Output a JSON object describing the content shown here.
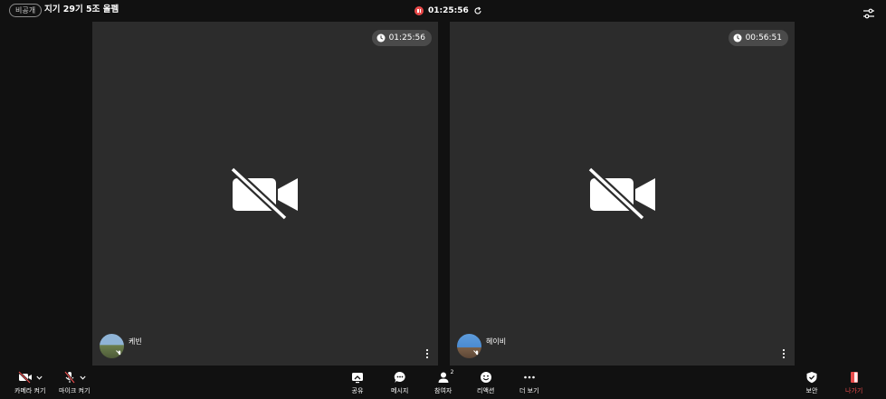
{
  "header": {
    "privacy_label": "비공개",
    "meeting_title": "지기 29기 5조 올펨",
    "record_time": "01:25:56"
  },
  "tiles": [
    {
      "timer": "01:25:56",
      "participant_name": "케빈"
    },
    {
      "timer": "00:56:51",
      "participant_name": "헤이비"
    }
  ],
  "toolbar": {
    "camera_label": "카메라 켜기",
    "mic_label": "마이크 켜기",
    "share_label": "공유",
    "message_label": "메시지",
    "participants_label": "참여자",
    "participants_count": "2",
    "reaction_label": "리액션",
    "more_label": "더 보기",
    "security_label": "보안",
    "leave_label": "나가기"
  },
  "colors": {
    "background": "#111111",
    "tile": "#2c2c2c",
    "record_red": "#e84a4a",
    "leave_red": "#e84a4a"
  },
  "icons": [
    "record-icon",
    "refresh-icon",
    "settings-sliders-icon",
    "clock-icon",
    "camera-off-icon",
    "mic-off-icon",
    "more-vertical-icon",
    "chevron-down-icon",
    "share-icon",
    "message-icon",
    "participants-icon",
    "reaction-icon",
    "more-horizontal-icon",
    "shield-icon",
    "exit-door-icon"
  ]
}
